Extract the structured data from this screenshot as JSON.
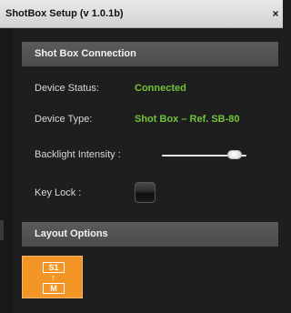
{
  "window": {
    "title": "ShotBox Setup (v 1.0.1b)",
    "close_glyph": "×"
  },
  "connection": {
    "header": "Shot Box Connection",
    "status_label": "Device Status:",
    "status_value": "Connected",
    "type_label": "Device Type:",
    "type_value": "Shot Box – Ref. SB-80",
    "backlight_label": "Backlight Intensity :",
    "backlight_level": 0.86,
    "keylock_label": "Key Lock :"
  },
  "layout": {
    "header": "Layout Options",
    "tile_top": "S1",
    "tile_arrow": "↑",
    "tile_bottom": "M"
  },
  "colors": {
    "accent": "#f29525",
    "status_green": "#73c23a",
    "header_bg": "#555555",
    "background": "#1f1f1f"
  }
}
